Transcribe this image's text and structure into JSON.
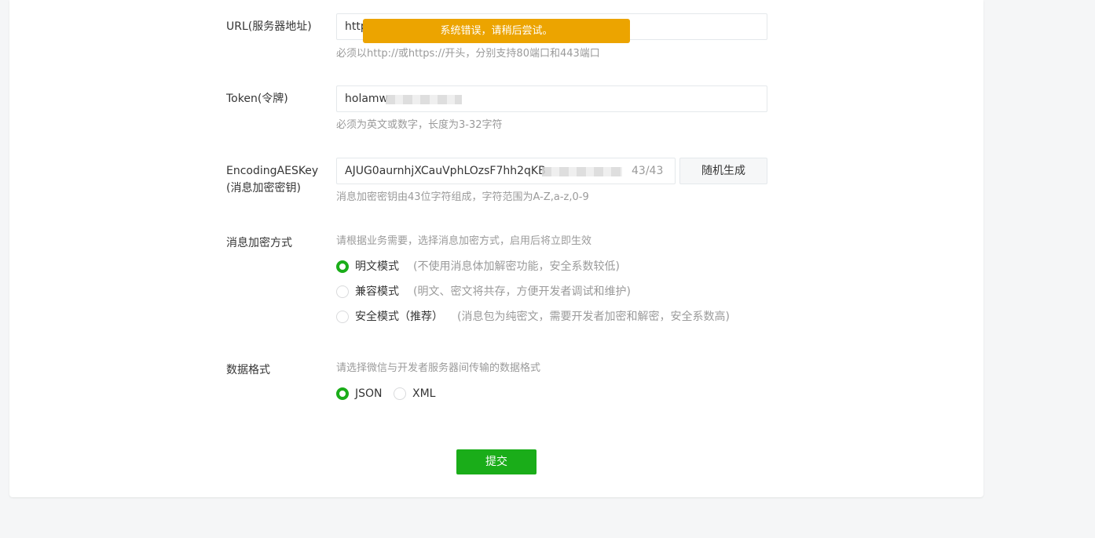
{
  "form": {
    "url": {
      "label": "URL(服务器地址)",
      "value": "http",
      "tip": "必须以http://或https://开头，分别支持80端口和443端口"
    },
    "token": {
      "label": "Token(令牌)",
      "value": "holamw",
      "tip": "必须为英文或数字，长度为3-32字符"
    },
    "aes": {
      "label_line1": "EncodingAESKey",
      "label_line2": "(消息加密密钥)",
      "value": "AJUG0aurnhjXCauVphLOzsF7hh2qKB",
      "counter": "43/43",
      "random_button": "随机生成",
      "tip": "消息加密密钥由43位字符组成，字符范围为A-Z,a-z,0-9"
    },
    "encrypt_mode": {
      "label": "消息加密方式",
      "tip": "请根据业务需要，选择消息加密方式，启用后将立即生效",
      "options": [
        {
          "label": "明文模式",
          "desc": "(不使用消息体加解密功能，安全系数较低)",
          "checked": true
        },
        {
          "label": "兼容模式",
          "desc": "(明文、密文将共存，方便开发者调试和维护)",
          "checked": false
        },
        {
          "label": "安全模式（推荐）",
          "desc": "(消息包为纯密文，需要开发者加密和解密，安全系数高)",
          "checked": false
        }
      ]
    },
    "data_format": {
      "label": "数据格式",
      "tip": "请选择微信与开发者服务器间传输的数据格式",
      "options": [
        {
          "label": "JSON",
          "checked": true
        },
        {
          "label": "XML",
          "checked": false
        }
      ]
    },
    "submit_label": "提交"
  },
  "toast": {
    "message": "系统错误，请稍后尝试。",
    "color": "#eca400"
  },
  "colors": {
    "accent": "#1aad19",
    "tip": "#9a9a9a"
  }
}
